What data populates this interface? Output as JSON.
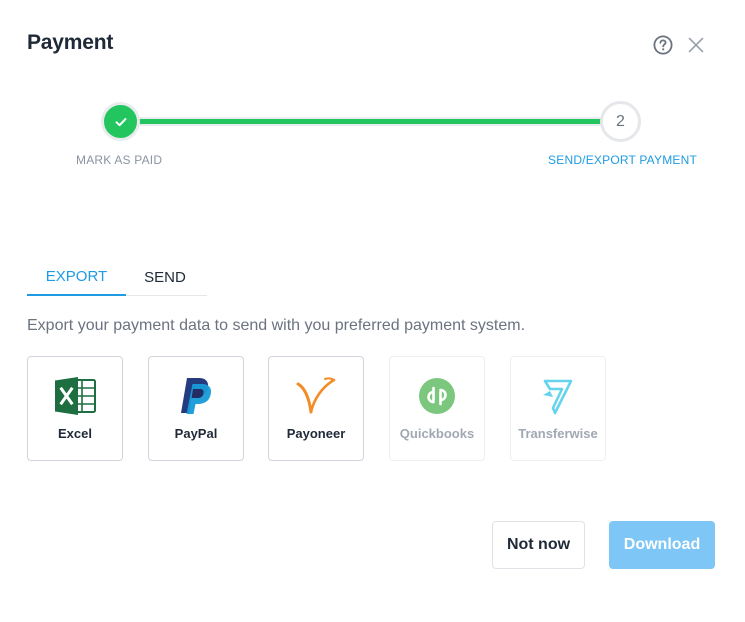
{
  "dialog": {
    "title": "Payment"
  },
  "header_icons": {
    "help": "help-circle-icon",
    "close": "close-icon"
  },
  "stepper": {
    "steps": [
      {
        "label": "MARK AS PAID",
        "state": "completed",
        "icon": "check-icon"
      },
      {
        "label": "SEND/EXPORT PAYMENT",
        "number": "2",
        "state": "current"
      }
    ],
    "progress": 1.0,
    "colors": {
      "done": "#22c55e",
      "active_label": "#1e9be3"
    }
  },
  "tabs": [
    {
      "label": "EXPORT",
      "active": true
    },
    {
      "label": "SEND",
      "active": false
    }
  ],
  "description": "Export your payment data to send with you preferred payment system.",
  "providers": [
    {
      "name": "Excel",
      "icon": "excel-icon",
      "enabled": true
    },
    {
      "name": "PayPal",
      "icon": "paypal-icon",
      "enabled": true
    },
    {
      "name": "Payoneer",
      "icon": "payoneer-icon",
      "enabled": true
    },
    {
      "name": "Quickbooks",
      "icon": "quickbooks-icon",
      "enabled": false
    },
    {
      "name": "Transferwise",
      "icon": "transferwise-icon",
      "enabled": false
    }
  ],
  "actions": {
    "not_now": "Not now",
    "download": "Download"
  },
  "colors": {
    "accent": "#1e9be3",
    "download_bg": "#7dc6f5"
  }
}
